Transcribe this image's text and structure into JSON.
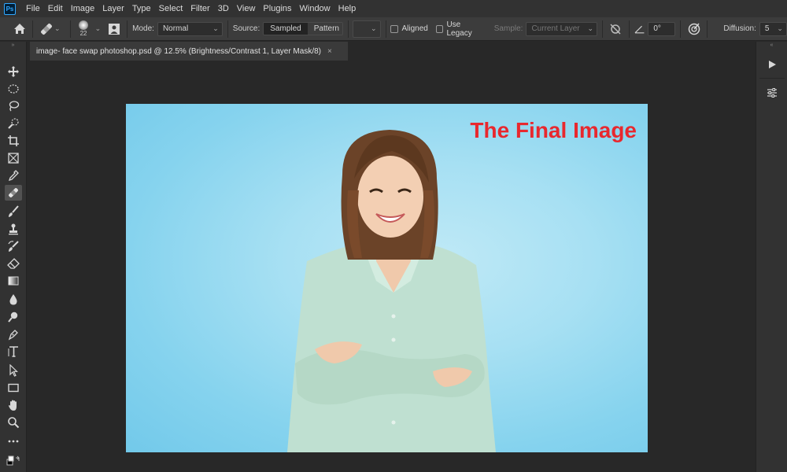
{
  "app": {
    "logo_text": "Ps"
  },
  "menu": [
    "File",
    "Edit",
    "Image",
    "Layer",
    "Type",
    "Select",
    "Filter",
    "3D",
    "View",
    "Plugins",
    "Window",
    "Help"
  ],
  "options": {
    "brush_size": "22",
    "mode_label": "Mode:",
    "mode_value": "Normal",
    "source_label": "Source:",
    "source_sampled": "Sampled",
    "source_pattern": "Pattern",
    "aligned_label": "Aligned",
    "use_legacy_label": "Use Legacy",
    "sample_label": "Sample:",
    "sample_value": "Current Layer",
    "angle_value": "0°",
    "diffusion_label": "Diffusion:",
    "diffusion_value": "5"
  },
  "document": {
    "tab_title": "image- face swap photoshop.psd @ 12.5% (Brightness/Contrast 1, Layer Mask/8)",
    "close_glyph": "×"
  },
  "canvas": {
    "overlay_text": "The Final Image"
  },
  "colors": {
    "menubar": "#323232",
    "optionsbar": "#3c3c3c",
    "canvas_bg": "#282828",
    "photo_bg": "#a7e0f3",
    "overlay_text": "#e8282e"
  }
}
